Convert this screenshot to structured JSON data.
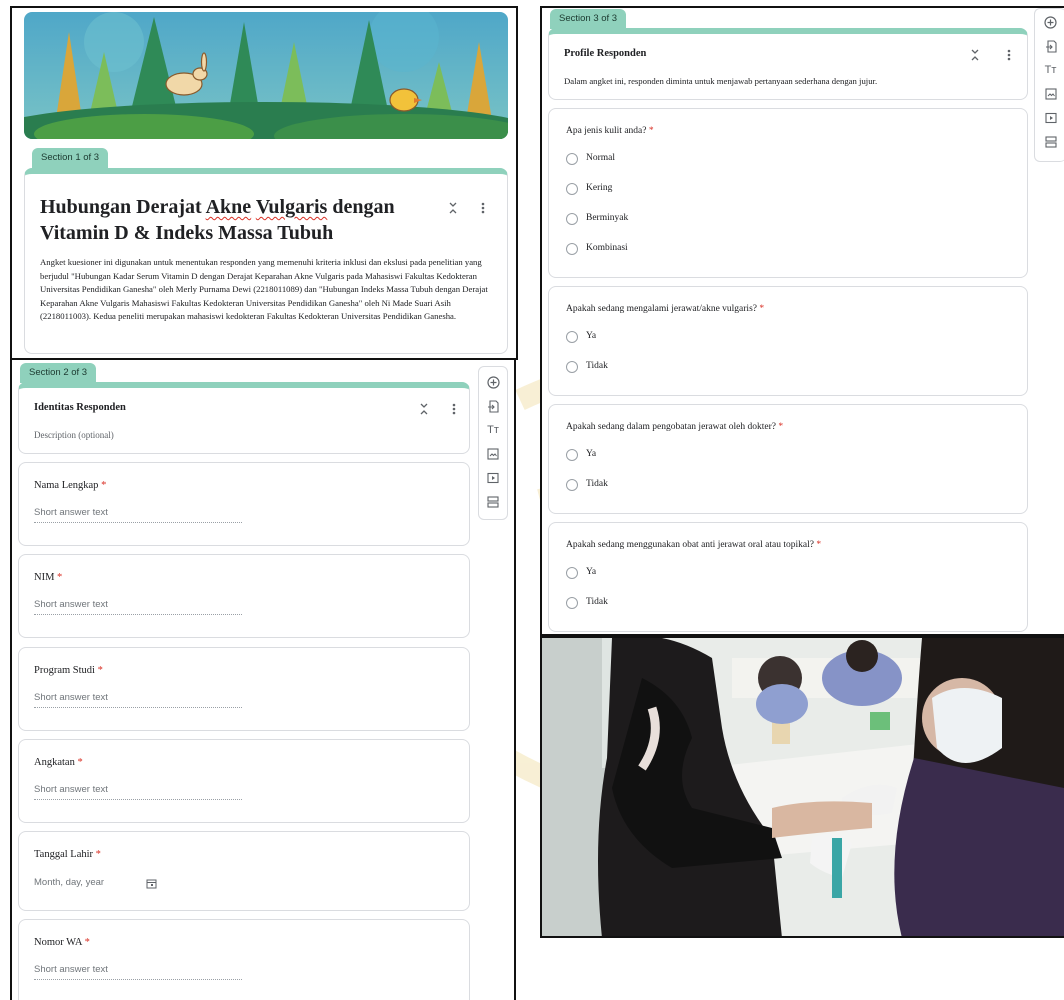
{
  "section1": {
    "tab": "Section 1 of 3",
    "title_pre": "Hubungan Derajat ",
    "title_sq1": "Akne",
    "title_sp": " ",
    "title_sq2": "Vulgaris",
    "title_post": " dengan",
    "title_line2": "Vitamin D & Indeks Massa Tubuh",
    "description": "Angket kuesioner ini digunakan untuk menentukan responden yang memenuhi kriteria inklusi dan ekslusi pada penelitian yang berjudul \"Hubungan Kadar Serum Vitamin D dengan Derajat Keparahan Akne Vulgaris pada Mahasiswi Fakultas Kedokteran Universitas Pendidikan Ganesha\" oleh Merly Purnama Dewi (2218011089) dan \"Hubungan Indeks Massa Tubuh dengan Derajat Keparahan Akne Vulgaris Mahasiswi Fakultas Kedokteran Universitas Pendidikan Ganesha\" oleh Ni Made Suari Asih (2218011003). Kedua peneliti merupakan mahasiswi kedokteran Fakultas Kedokteran Universitas Pendidikan Ganesha."
  },
  "section2": {
    "tab": "Section 2 of 3",
    "title": "Identitas Responden",
    "description": "Description (optional)",
    "required_mark": "*",
    "questions": [
      {
        "label": "Nama Lengkap",
        "placeholder": "Short answer text"
      },
      {
        "label": "NIM",
        "placeholder": "Short answer text"
      },
      {
        "label": "Program Studi",
        "placeholder": "Short answer text"
      },
      {
        "label": "Angkatan",
        "placeholder": "Short answer text"
      },
      {
        "label": "Tanggal Lahir",
        "placeholder": "Month, day, year"
      },
      {
        "label": "Nomor WA",
        "placeholder": "Short answer text"
      }
    ]
  },
  "section3": {
    "tab": "Section 3 of 3",
    "title": "Profile Responden",
    "description": "Dalam angket ini, responden diminta untuk menjawab pertanyaan sederhana dengan jujur.",
    "required_mark": "*",
    "questions": [
      {
        "label": "Apa jenis kulit anda?",
        "options": [
          "Normal",
          "Kering",
          "Berminyak",
          "Kombinasi"
        ]
      },
      {
        "label": "Apakah sedang mengalami jerawat/akne vulgaris?",
        "options": [
          "Ya",
          "Tidak"
        ]
      },
      {
        "label": "Apakah sedang dalam pengobatan jerawat oleh dokter?",
        "options": [
          "Ya",
          "Tidak"
        ]
      },
      {
        "label": "Apakah sedang menggunakan obat anti jerawat oral atau topikal?",
        "options": [
          "Ya",
          "Tidak"
        ]
      }
    ]
  },
  "toolbar": {
    "add_question": "add-circle-icon",
    "import_questions": "import-icon",
    "add_title": "Tт",
    "add_image": "image-icon",
    "add_video": "video-icon",
    "add_section": "section-icon"
  },
  "colors": {
    "accent": "#8fd1bc",
    "required": "#d93025",
    "border": "#dadce0"
  }
}
